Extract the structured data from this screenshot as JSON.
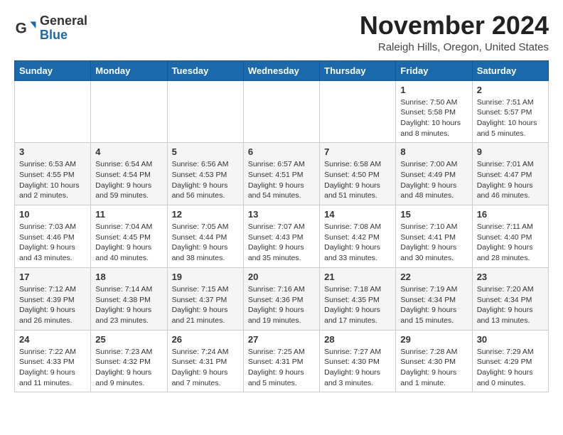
{
  "header": {
    "logo_line1": "General",
    "logo_line2": "Blue",
    "month_title": "November 2024",
    "location": "Raleigh Hills, Oregon, United States"
  },
  "weekdays": [
    "Sunday",
    "Monday",
    "Tuesday",
    "Wednesday",
    "Thursday",
    "Friday",
    "Saturday"
  ],
  "weeks": [
    [
      {
        "day": "",
        "info": ""
      },
      {
        "day": "",
        "info": ""
      },
      {
        "day": "",
        "info": ""
      },
      {
        "day": "",
        "info": ""
      },
      {
        "day": "",
        "info": ""
      },
      {
        "day": "1",
        "info": "Sunrise: 7:50 AM\nSunset: 5:58 PM\nDaylight: 10 hours\nand 8 minutes."
      },
      {
        "day": "2",
        "info": "Sunrise: 7:51 AM\nSunset: 5:57 PM\nDaylight: 10 hours\nand 5 minutes."
      }
    ],
    [
      {
        "day": "3",
        "info": "Sunrise: 6:53 AM\nSunset: 4:55 PM\nDaylight: 10 hours\nand 2 minutes."
      },
      {
        "day": "4",
        "info": "Sunrise: 6:54 AM\nSunset: 4:54 PM\nDaylight: 9 hours\nand 59 minutes."
      },
      {
        "day": "5",
        "info": "Sunrise: 6:56 AM\nSunset: 4:53 PM\nDaylight: 9 hours\nand 56 minutes."
      },
      {
        "day": "6",
        "info": "Sunrise: 6:57 AM\nSunset: 4:51 PM\nDaylight: 9 hours\nand 54 minutes."
      },
      {
        "day": "7",
        "info": "Sunrise: 6:58 AM\nSunset: 4:50 PM\nDaylight: 9 hours\nand 51 minutes."
      },
      {
        "day": "8",
        "info": "Sunrise: 7:00 AM\nSunset: 4:49 PM\nDaylight: 9 hours\nand 48 minutes."
      },
      {
        "day": "9",
        "info": "Sunrise: 7:01 AM\nSunset: 4:47 PM\nDaylight: 9 hours\nand 46 minutes."
      }
    ],
    [
      {
        "day": "10",
        "info": "Sunrise: 7:03 AM\nSunset: 4:46 PM\nDaylight: 9 hours\nand 43 minutes."
      },
      {
        "day": "11",
        "info": "Sunrise: 7:04 AM\nSunset: 4:45 PM\nDaylight: 9 hours\nand 40 minutes."
      },
      {
        "day": "12",
        "info": "Sunrise: 7:05 AM\nSunset: 4:44 PM\nDaylight: 9 hours\nand 38 minutes."
      },
      {
        "day": "13",
        "info": "Sunrise: 7:07 AM\nSunset: 4:43 PM\nDaylight: 9 hours\nand 35 minutes."
      },
      {
        "day": "14",
        "info": "Sunrise: 7:08 AM\nSunset: 4:42 PM\nDaylight: 9 hours\nand 33 minutes."
      },
      {
        "day": "15",
        "info": "Sunrise: 7:10 AM\nSunset: 4:41 PM\nDaylight: 9 hours\nand 30 minutes."
      },
      {
        "day": "16",
        "info": "Sunrise: 7:11 AM\nSunset: 4:40 PM\nDaylight: 9 hours\nand 28 minutes."
      }
    ],
    [
      {
        "day": "17",
        "info": "Sunrise: 7:12 AM\nSunset: 4:39 PM\nDaylight: 9 hours\nand 26 minutes."
      },
      {
        "day": "18",
        "info": "Sunrise: 7:14 AM\nSunset: 4:38 PM\nDaylight: 9 hours\nand 23 minutes."
      },
      {
        "day": "19",
        "info": "Sunrise: 7:15 AM\nSunset: 4:37 PM\nDaylight: 9 hours\nand 21 minutes."
      },
      {
        "day": "20",
        "info": "Sunrise: 7:16 AM\nSunset: 4:36 PM\nDaylight: 9 hours\nand 19 minutes."
      },
      {
        "day": "21",
        "info": "Sunrise: 7:18 AM\nSunset: 4:35 PM\nDaylight: 9 hours\nand 17 minutes."
      },
      {
        "day": "22",
        "info": "Sunrise: 7:19 AM\nSunset: 4:34 PM\nDaylight: 9 hours\nand 15 minutes."
      },
      {
        "day": "23",
        "info": "Sunrise: 7:20 AM\nSunset: 4:34 PM\nDaylight: 9 hours\nand 13 minutes."
      }
    ],
    [
      {
        "day": "24",
        "info": "Sunrise: 7:22 AM\nSunset: 4:33 PM\nDaylight: 9 hours\nand 11 minutes."
      },
      {
        "day": "25",
        "info": "Sunrise: 7:23 AM\nSunset: 4:32 PM\nDaylight: 9 hours\nand 9 minutes."
      },
      {
        "day": "26",
        "info": "Sunrise: 7:24 AM\nSunset: 4:31 PM\nDaylight: 9 hours\nand 7 minutes."
      },
      {
        "day": "27",
        "info": "Sunrise: 7:25 AM\nSunset: 4:31 PM\nDaylight: 9 hours\nand 5 minutes."
      },
      {
        "day": "28",
        "info": "Sunrise: 7:27 AM\nSunset: 4:30 PM\nDaylight: 9 hours\nand 3 minutes."
      },
      {
        "day": "29",
        "info": "Sunrise: 7:28 AM\nSunset: 4:30 PM\nDaylight: 9 hours\nand 1 minute."
      },
      {
        "day": "30",
        "info": "Sunrise: 7:29 AM\nSunset: 4:29 PM\nDaylight: 9 hours\nand 0 minutes."
      }
    ]
  ]
}
